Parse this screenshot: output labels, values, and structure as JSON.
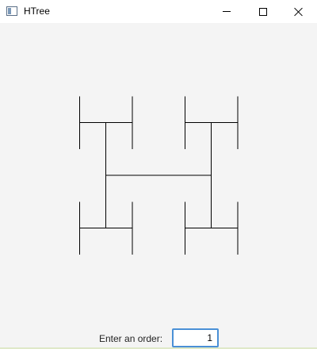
{
  "window": {
    "title": "HTree",
    "icon": "app-window-icon",
    "controls": {
      "minimize": "minimize-icon",
      "maximize": "maximize-icon",
      "close": "close-icon"
    }
  },
  "htree": {
    "order": 1,
    "line_color": "#000000"
  },
  "controls": {
    "order_label": "Enter an order:",
    "order_value": "1"
  },
  "colors": {
    "background": "#f4f4f4",
    "titlebar": "#ffffff",
    "input_border": "#4a90d6"
  }
}
